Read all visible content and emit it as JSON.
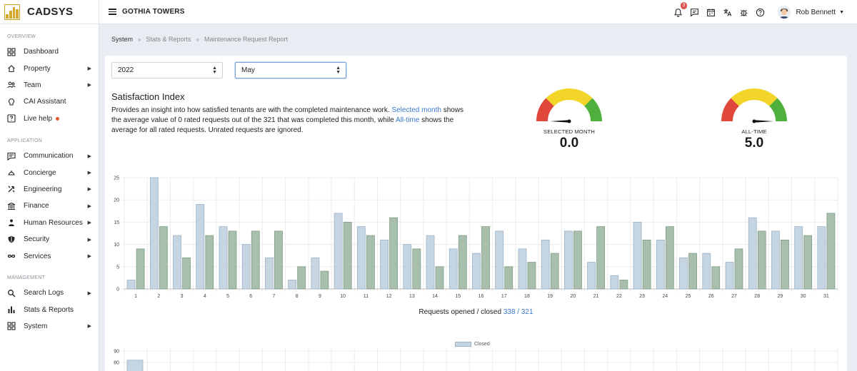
{
  "app": {
    "name": "CADSYS"
  },
  "sidebar": {
    "sections": [
      {
        "title": "OVERVIEW",
        "items": [
          {
            "label": "Dashboard",
            "icon": "dashboard-icon",
            "chevron": false
          },
          {
            "label": "Property",
            "icon": "home-icon",
            "chevron": true
          },
          {
            "label": "Team",
            "icon": "team-icon",
            "chevron": true
          },
          {
            "label": "CAI Assistant",
            "icon": "assistant-icon",
            "chevron": false
          },
          {
            "label": "Live help",
            "icon": "help-square-icon",
            "chevron": false,
            "dot": true
          }
        ]
      },
      {
        "title": "APPLICATION",
        "items": [
          {
            "label": "Communication",
            "icon": "chat-icon",
            "chevron": true
          },
          {
            "label": "Concierge",
            "icon": "concierge-icon",
            "chevron": true
          },
          {
            "label": "Engineering",
            "icon": "tools-icon",
            "chevron": true
          },
          {
            "label": "Finance",
            "icon": "bank-icon",
            "chevron": true
          },
          {
            "label": "Human Resources",
            "icon": "hr-icon",
            "chevron": true
          },
          {
            "label": "Security",
            "icon": "shield-icon",
            "chevron": true
          },
          {
            "label": "Services",
            "icon": "infinity-icon",
            "chevron": true
          }
        ]
      },
      {
        "title": "MANAGEMENT",
        "items": [
          {
            "label": "Search Logs",
            "icon": "search-icon",
            "chevron": true
          },
          {
            "label": "Stats & Reports",
            "icon": "bar-chart-icon",
            "chevron": false
          },
          {
            "label": "System",
            "icon": "grid-icon",
            "chevron": true
          }
        ]
      }
    ]
  },
  "topbar": {
    "property": "GOTHIA TOWERS",
    "notification_count": "3",
    "user_name": "Rob Bennett",
    "icons": [
      "bell-icon",
      "message-icon",
      "calendar-icon",
      "translate-icon",
      "bug-icon",
      "help-icon"
    ]
  },
  "breadcrumb": [
    "System",
    "Stats & Reports",
    "Maintenance Request Report"
  ],
  "filters": {
    "year": "2022",
    "month": "May"
  },
  "satisfaction": {
    "title": "Satisfaction Index",
    "desc_1": "Provides an insight into how satisfied tenants are with the completed maintenance work. ",
    "link_selected": "Selected month",
    "desc_2": " shows the average value of 0 rated requests out of the 321 that was completed this month, while ",
    "link_alltime": "All-time",
    "desc_3": " shows the average for all rated requests. Unrated requests are ignored.",
    "gauges": [
      {
        "label": "SELECTED MONTH",
        "value": "0.0",
        "level": 0.0
      },
      {
        "label": "ALL-TIME",
        "value": "5.0",
        "level": 5.0
      }
    ],
    "gauge_colors": [
      "#e0483b",
      "#f3d428",
      "#4fb03e"
    ]
  },
  "chart_caption": {
    "prefix": "Requests opened / closed ",
    "opened": "338",
    "sep": " / ",
    "closed": "321"
  },
  "chart_data": [
    {
      "type": "bar",
      "categories": [
        "1",
        "2",
        "3",
        "4",
        "5",
        "6",
        "7",
        "8",
        "9",
        "10",
        "11",
        "12",
        "13",
        "14",
        "15",
        "16",
        "17",
        "18",
        "19",
        "20",
        "21",
        "22",
        "23",
        "24",
        "25",
        "26",
        "27",
        "28",
        "29",
        "30",
        "31"
      ],
      "series": [
        {
          "values": [
            2,
            25,
            12,
            19,
            14,
            10,
            7,
            2,
            7,
            17,
            14,
            11,
            10,
            12,
            9,
            8,
            13,
            9,
            11,
            13,
            6,
            3,
            15,
            11,
            7,
            8,
            6,
            16,
            13,
            14,
            14
          ],
          "color": "#c6d5e2"
        },
        {
          "values": [
            9,
            14,
            7,
            12,
            13,
            13,
            13,
            5,
            4,
            15,
            12,
            16,
            9,
            5,
            12,
            14,
            5,
            6,
            8,
            13,
            14,
            2,
            11,
            14,
            8,
            5,
            9,
            13,
            11,
            12,
            17
          ],
          "color": "#a9bfad"
        }
      ],
      "ylim": [
        0,
        25
      ],
      "yticks": [
        "0",
        "5",
        "10",
        "15",
        "20",
        "25"
      ],
      "grid": true
    },
    {
      "type": "bar",
      "legend": [
        "Closed"
      ],
      "yticks": [
        "80",
        "90"
      ],
      "grid": true,
      "first_value": 82
    }
  ]
}
